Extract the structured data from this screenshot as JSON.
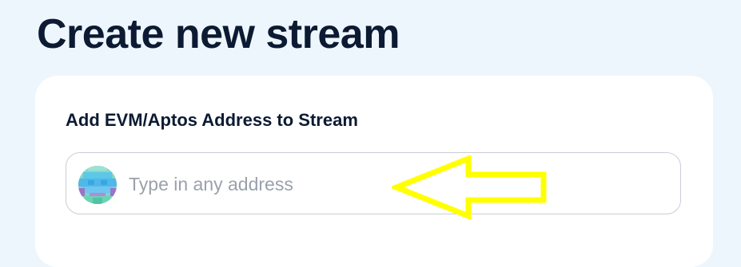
{
  "page": {
    "title": "Create new stream"
  },
  "form": {
    "address_label": "Add EVM/Aptos Address to Stream",
    "address_input": {
      "value": "",
      "placeholder": "Type in any address"
    },
    "avatar": {
      "icon": "identicon-avatar-icon"
    }
  },
  "annotation": {
    "icon": "arrow-left-icon",
    "color": "#ffff00"
  },
  "colors": {
    "background": "#eef6fd",
    "card": "#ffffff",
    "heading": "#0c1b33",
    "placeholder": "#9aa1ab",
    "field_border": "#c9ced6"
  }
}
